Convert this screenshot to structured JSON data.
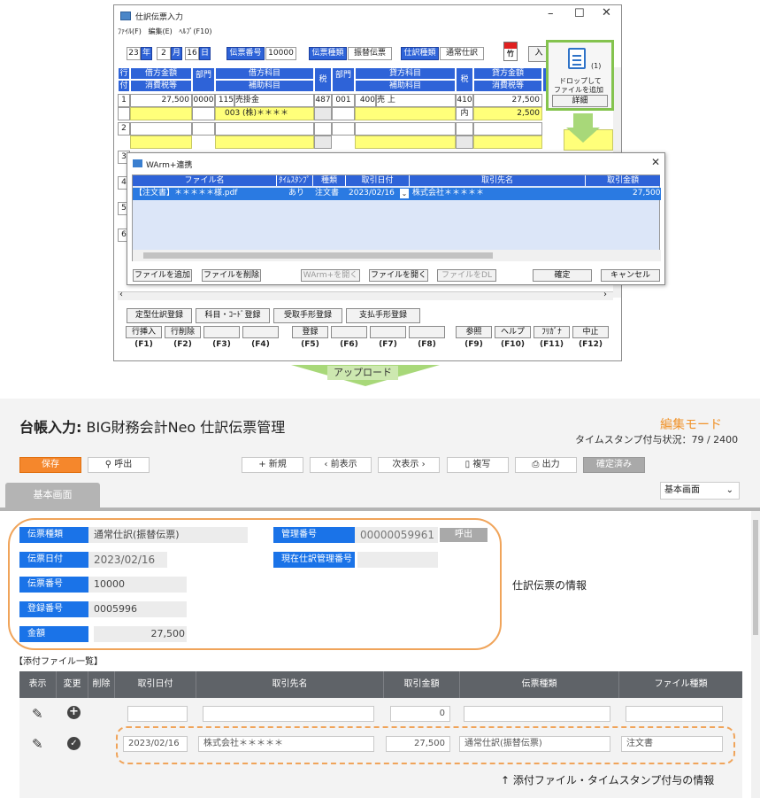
{
  "desktop": {
    "window_title": "仕訳伝票入力",
    "menu": [
      "ﾌｧｲﾙ(F)",
      "編集(E)",
      "ﾍﾙﾌﾟ(F10)"
    ],
    "date": {
      "year": "23",
      "year_label": "年",
      "month": "2",
      "month_label": "月",
      "day": "16",
      "day_label": "日"
    },
    "slip_no_label": "伝票番号",
    "slip_no": "10000",
    "slip_kind_label": "伝票種類",
    "slip_kind": "振替伝票",
    "journal_kind_label": "仕訳種類",
    "journal_kind": "通常仕訳",
    "enter_button": "入",
    "grid_headers": {
      "row": "行",
      "attach": "付",
      "debit_amount": "借方金額",
      "tax_amount": "消費税等",
      "dept": "部門",
      "debit_account": "借方科目",
      "sub_account": "補助科目",
      "tax": "税",
      "dept2": "部門",
      "credit_account": "貸方科目",
      "sub_account2": "補助科目",
      "tax2": "税",
      "credit_amount": "貸方金額",
      "tax_amount2": "消費税等"
    },
    "row1": {
      "no": "1",
      "debit_amount": "27,500",
      "dept": "0000",
      "account_code": "115",
      "account_name": "売掛金",
      "sub_account": "003 (株)＊＊＊＊",
      "tax_code": "487",
      "dept2": "001",
      "credit_code": "400",
      "credit_name": "売  上",
      "tax2": "410",
      "tax2_kind": "内",
      "credit_amount": "27,500",
      "tax_amount": "2,500"
    },
    "row_numbers": [
      "2",
      "3",
      "4",
      "5",
      "6"
    ],
    "drop_zone": {
      "count": "(1)",
      "text1": "ドロップして",
      "text2": "ファイルを追加",
      "detail_button": "詳細"
    },
    "dialog": {
      "title": "WArm+連携",
      "headers": [
        "ファイル名",
        "ﾀｲﾑｽﾀﾝﾌﾟ",
        "種類",
        "取引日付",
        "取引先名",
        "取引金額"
      ],
      "row": [
        "【注文書】＊＊＊＊＊様.pdf",
        "あり",
        "注文書",
        "2023/02/16",
        "株式会社＊＊＊＊＊",
        "27,500"
      ],
      "buttons": [
        "ファイルを追加",
        "ファイルを削除",
        "WArm+を開く",
        "ファイルを開く",
        "ファイルをDL",
        "確定",
        "キャンセル"
      ]
    },
    "bottom_buttons": [
      "定型仕訳登録",
      "科目・ｺｰﾄﾞ登録",
      "受取手形登録",
      "支払手形登録"
    ],
    "fkeys": [
      {
        "label": "行挿入",
        "key": "(F1)"
      },
      {
        "label": "行削除",
        "key": "(F2)"
      },
      {
        "label": "",
        "key": "(F3)"
      },
      {
        "label": "",
        "key": "(F4)"
      },
      {
        "label": "登録",
        "key": "(F5)"
      },
      {
        "label": "",
        "key": "(F6)"
      },
      {
        "label": "",
        "key": "(F7)"
      },
      {
        "label": "",
        "key": "(F8)"
      },
      {
        "label": "参照",
        "key": "(F9)"
      },
      {
        "label": "ヘルプ",
        "key": "(F10)"
      },
      {
        "label": "ﾌﾘｶﾞﾅ",
        "key": "(F11)"
      },
      {
        "label": "中止",
        "key": "(F12)"
      }
    ]
  },
  "upload_label": "アップロード",
  "web": {
    "title_prefix": "台帳入力:",
    "title": "BIG財務会計Neo 仕訳伝票管理",
    "edit_mode": "編集モード",
    "timestamp_status": "タイムスタンプ付与状況：79 / 2400",
    "toolbar": {
      "save": "保存",
      "call": "呼出",
      "new": "新規",
      "prev": "前表示",
      "next": "次表示",
      "copy": "複写",
      "print": "出力",
      "confirmed": "確定済み"
    },
    "tab": "基本画面",
    "view_select": "基本画面",
    "form": {
      "slip_kind_label": "伝票種類",
      "slip_kind": "通常仕訳(振替伝票)",
      "slip_date_label": "伝票日付",
      "slip_date": "2023/02/16",
      "slip_no_label": "伝票番号",
      "slip_no": "10000",
      "reg_no_label": "登録番号",
      "reg_no": "0005996",
      "amount_label": "金額",
      "amount": "27,500",
      "mgmt_no_label": "管理番号",
      "mgmt_no": "00000059961",
      "call_button": "呼出",
      "current_mgmt_label": "現在仕訳管理番号",
      "current_mgmt": ""
    },
    "annotation_top": "仕訳伝票の情報",
    "attach_list_label": "【添付ファイル一覧】",
    "table_headers": [
      "表示",
      "変更",
      "削除",
      "取引日付",
      "取引先名",
      "取引金額",
      "伝票種類",
      "ファイル種類"
    ],
    "row_new": {
      "date": "",
      "partner": "",
      "amount": "0",
      "slip_kind": "",
      "file_kind": ""
    },
    "row_file": {
      "date": "2023/02/16",
      "partner": "株式会社＊＊＊＊＊",
      "amount": "27,500",
      "slip_kind": "通常仕訳(振替伝票)",
      "file_kind": "注文書"
    },
    "annotation_bottom": "↑ 添付ファイル・タイムスタンプ付与の情報"
  },
  "colors": {
    "accent": "#f5872c",
    "blue": "#1a73e8",
    "legacy_blue": "#2e63d8",
    "green": "#84c34e"
  }
}
